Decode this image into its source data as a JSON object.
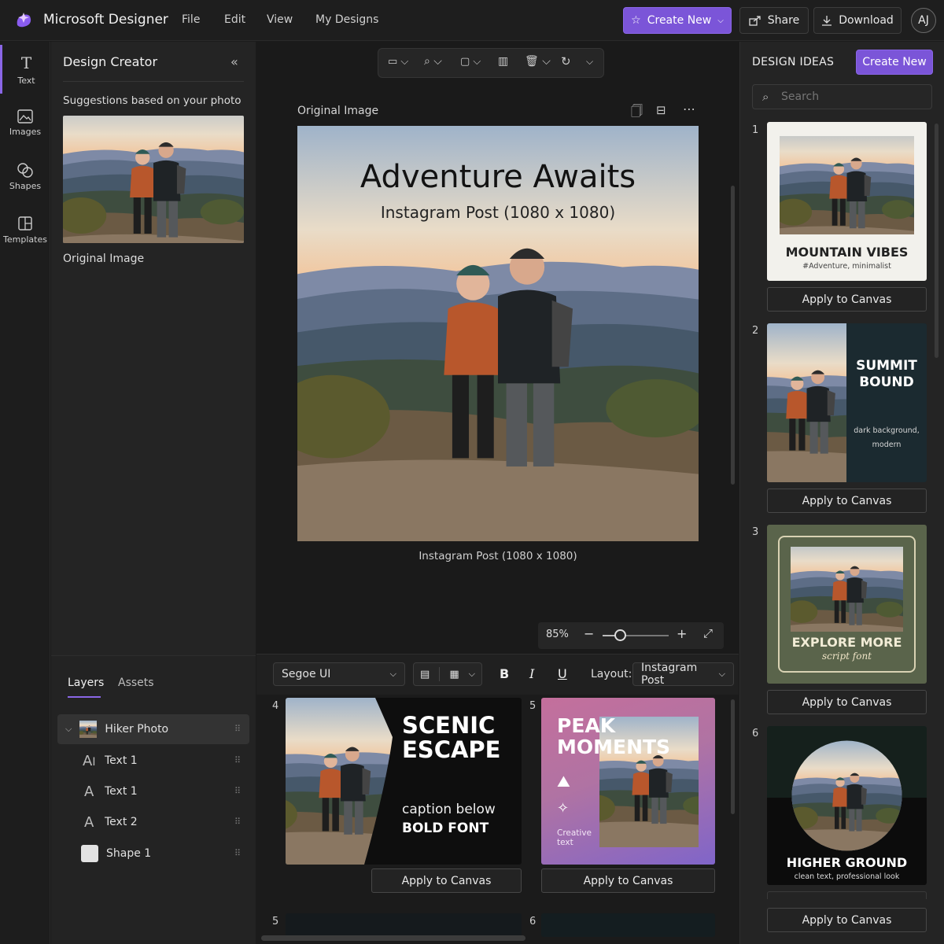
{
  "app": {
    "title": "Microsoft Designer"
  },
  "menu": [
    "File",
    "Edit",
    "View",
    "My Designs"
  ],
  "topbar": {
    "create_new": "Create New",
    "share": "Share",
    "download": "Download",
    "avatar": "AJ"
  },
  "rail": [
    {
      "label": "Text",
      "icon": "text-icon"
    },
    {
      "label": "Images",
      "icon": "images-icon"
    },
    {
      "label": "Shapes",
      "icon": "shapes-icon"
    },
    {
      "label": "Templates",
      "icon": "templates-icon"
    }
  ],
  "left_panel": {
    "title": "Design Creator",
    "suggestions_label": "Suggestions based on your photo",
    "original_label": "Original Image"
  },
  "layers_panel": {
    "tabs": [
      "Layers",
      "Assets"
    ],
    "layers": [
      {
        "name": "Hiker Photo",
        "icon": "photo-thumb-icon"
      },
      {
        "name": "Text 1",
        "icon": "ai-text-icon"
      },
      {
        "name": "Text 1",
        "icon": "text-icon"
      },
      {
        "name": "Text 2",
        "icon": "text-icon"
      },
      {
        "name": "Shape 1",
        "icon": "shape-icon"
      }
    ]
  },
  "canvas": {
    "header_label": "Original Image",
    "headline": "Adventure Awaits",
    "subhead": "Instagram Post (1080 x 1080)",
    "caption": "Instagram Post (1080 x 1080)",
    "zoom": "85%",
    "zoom_fraction": 0.27
  },
  "format_bar": {
    "font": "Segoe UI",
    "bold": "B",
    "italic": "I",
    "underline": "U",
    "layout_label": "Layout:",
    "layout_value": "Instagram Post"
  },
  "bottom_ideas": [
    {
      "num": "4",
      "title1": "SCENIC",
      "title2": "ESCAPE",
      "sub1": "caption below",
      "sub2": "BOLD FONT",
      "apply": "Apply to Canvas"
    },
    {
      "num": "5",
      "title1": "PEAK",
      "title2": "MOMENTS",
      "small": "Creative text",
      "apply": "Apply to Canvas"
    }
  ],
  "bottom_next": [
    "5",
    "6"
  ],
  "right_panel": {
    "title": "DESIGN IDEAS",
    "create_new": "Create New",
    "search_placeholder": "Search",
    "ideas": [
      {
        "num": "1",
        "title": "MOUNTAIN VIBES",
        "sub": "#Adventure, minimalist",
        "apply": "Apply to Canvas"
      },
      {
        "num": "2",
        "title1": "SUMMIT",
        "title2": "BOUND",
        "sub1": "dark background,",
        "sub2": "modern",
        "apply": "Apply to Canvas"
      },
      {
        "num": "3",
        "title": "EXPLORE MORE",
        "sub": "script font",
        "apply": "Apply to Canvas"
      },
      {
        "num": "6",
        "title": "HIGHER GROUND",
        "sub": "clean text, professional look",
        "apply": "Apply to Canvas"
      }
    ]
  },
  "colors": {
    "accent": "#7b55d8",
    "bg": "#1b1b1b",
    "panel": "#242424"
  }
}
